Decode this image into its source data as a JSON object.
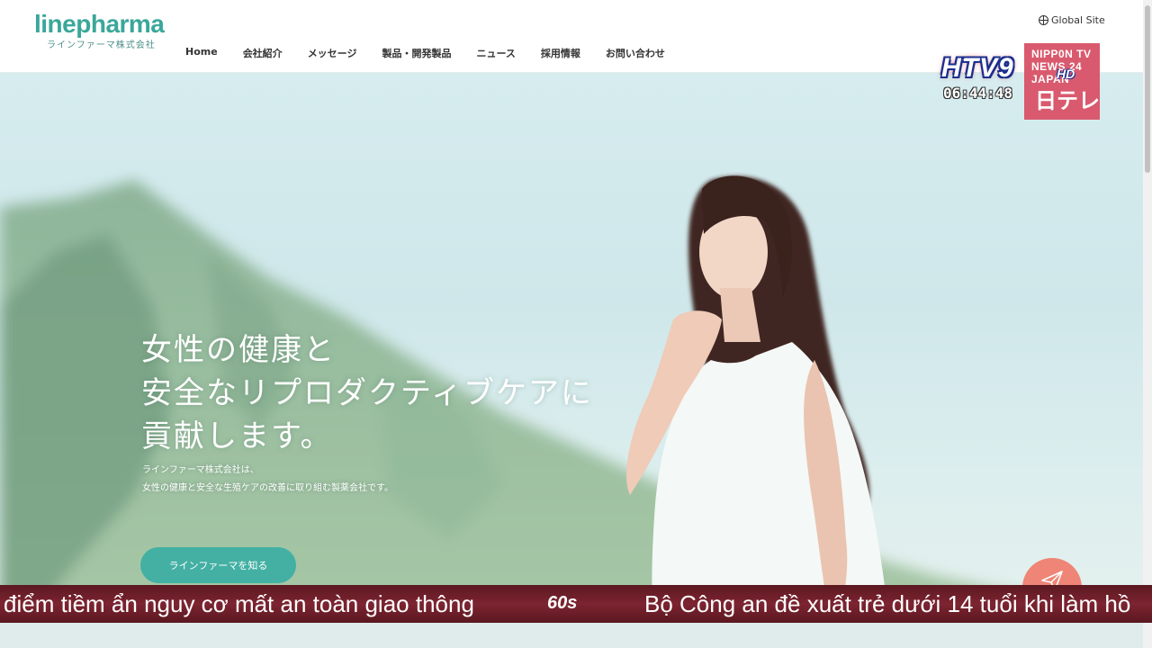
{
  "header": {
    "logo_text": "linepharma",
    "logo_subtitle": "ラインファーマ株式会社",
    "nav": [
      {
        "label": "Home"
      },
      {
        "label": "会社紹介"
      },
      {
        "label": "メッセージ"
      },
      {
        "label": "製品・開発製品"
      },
      {
        "label": "ニュース"
      },
      {
        "label": "採用情報"
      },
      {
        "label": "お問い合わせ"
      }
    ],
    "global_site": "Global Site"
  },
  "hero": {
    "headline": [
      "女性の健康と",
      "安全なリプロダクティブケアに",
      "貢献します。"
    ],
    "subcopy": [
      "ラインファーマ株式会社は、",
      "女性の健康と安全な生殖ケアの改善に取り組む製薬会社です。"
    ],
    "cta_label": "ラインファーマを知る",
    "fab_icon": "paper-plane-icon"
  },
  "broadcast": {
    "channel_logo": "HTV9",
    "channel_hd": "HD",
    "clock": "06:44:48",
    "ntv_lines": [
      "NIPP0N TV",
      "NEWS 24",
      "JAPAN"
    ],
    "ntv_logo": "日テレ",
    "ticker_left": "điểm tiềm ẩn nguy cơ mất an toàn giao thông",
    "ticker_separator": "60s",
    "ticker_right": "Bộ Công an đề xuất trẻ dưới 14 tuổi khi làm hồ"
  },
  "colors": {
    "brand_teal": "#3aa79a",
    "cta_teal": "#43b0a3",
    "fab_coral": "#ef8576",
    "ticker_red": "#7d2431",
    "ntv_pink": "#d95a6e"
  }
}
